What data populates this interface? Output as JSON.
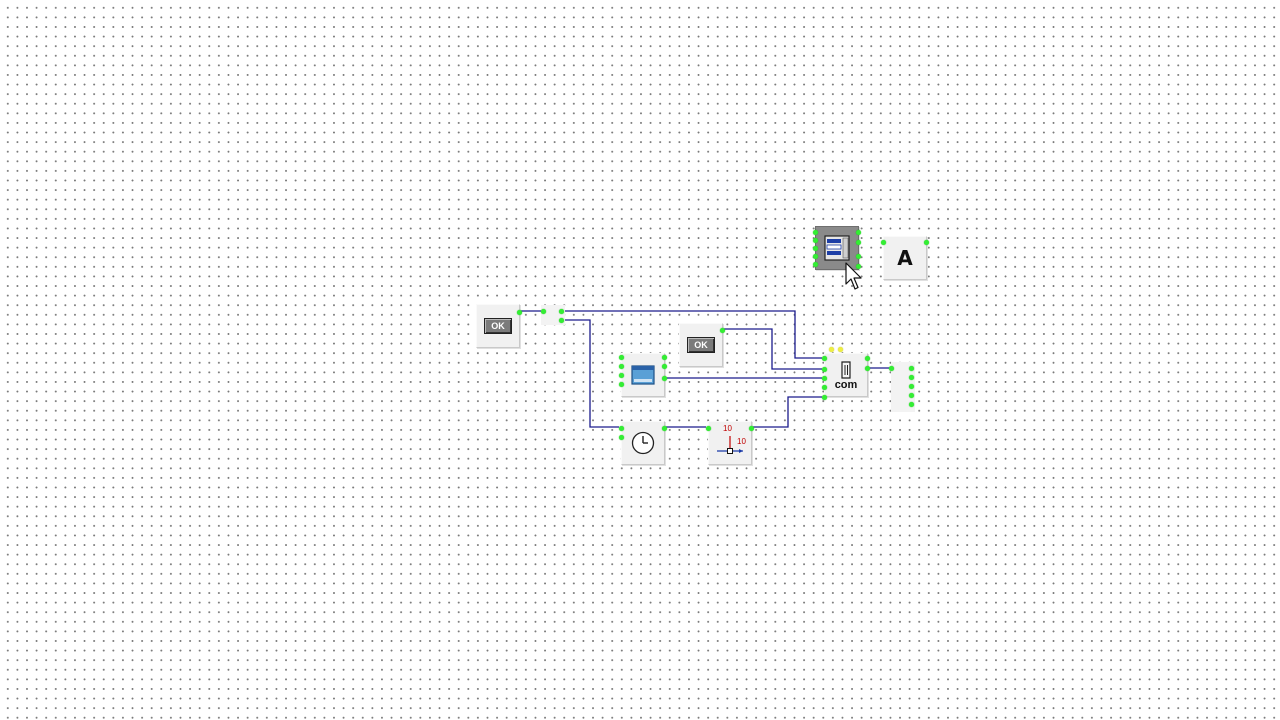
{
  "canvas": {
    "grid": "dotted"
  },
  "components": {
    "ok_button_1": {
      "label": "OK",
      "icon": "ok-button-icon"
    },
    "ok_button_2": {
      "label": "OK",
      "icon": "ok-button-icon"
    },
    "window_form": {
      "icon": "window-icon"
    },
    "timer": {
      "icon": "clock-icon"
    },
    "counter": {
      "icon": "axis-counter-icon",
      "num_top": "10",
      "num_right": "10"
    },
    "com_port": {
      "label": "com",
      "icon": "com-port-icon"
    },
    "list_box": {
      "icon": "listbox-icon",
      "selected": true
    },
    "text_label": {
      "label": "A",
      "icon": "text-label-icon"
    },
    "splitter_left": {
      "icon": "splitter-icon"
    },
    "splitter_right": {
      "icon": "splitter-icon"
    }
  },
  "colors": {
    "wire": "#1a1a8c",
    "pin": "#33ee33",
    "pin_alt": "#eeee44",
    "selected_bg": "#8a8a8a"
  },
  "cursor": {
    "icon": "mouse-pointer-icon"
  }
}
